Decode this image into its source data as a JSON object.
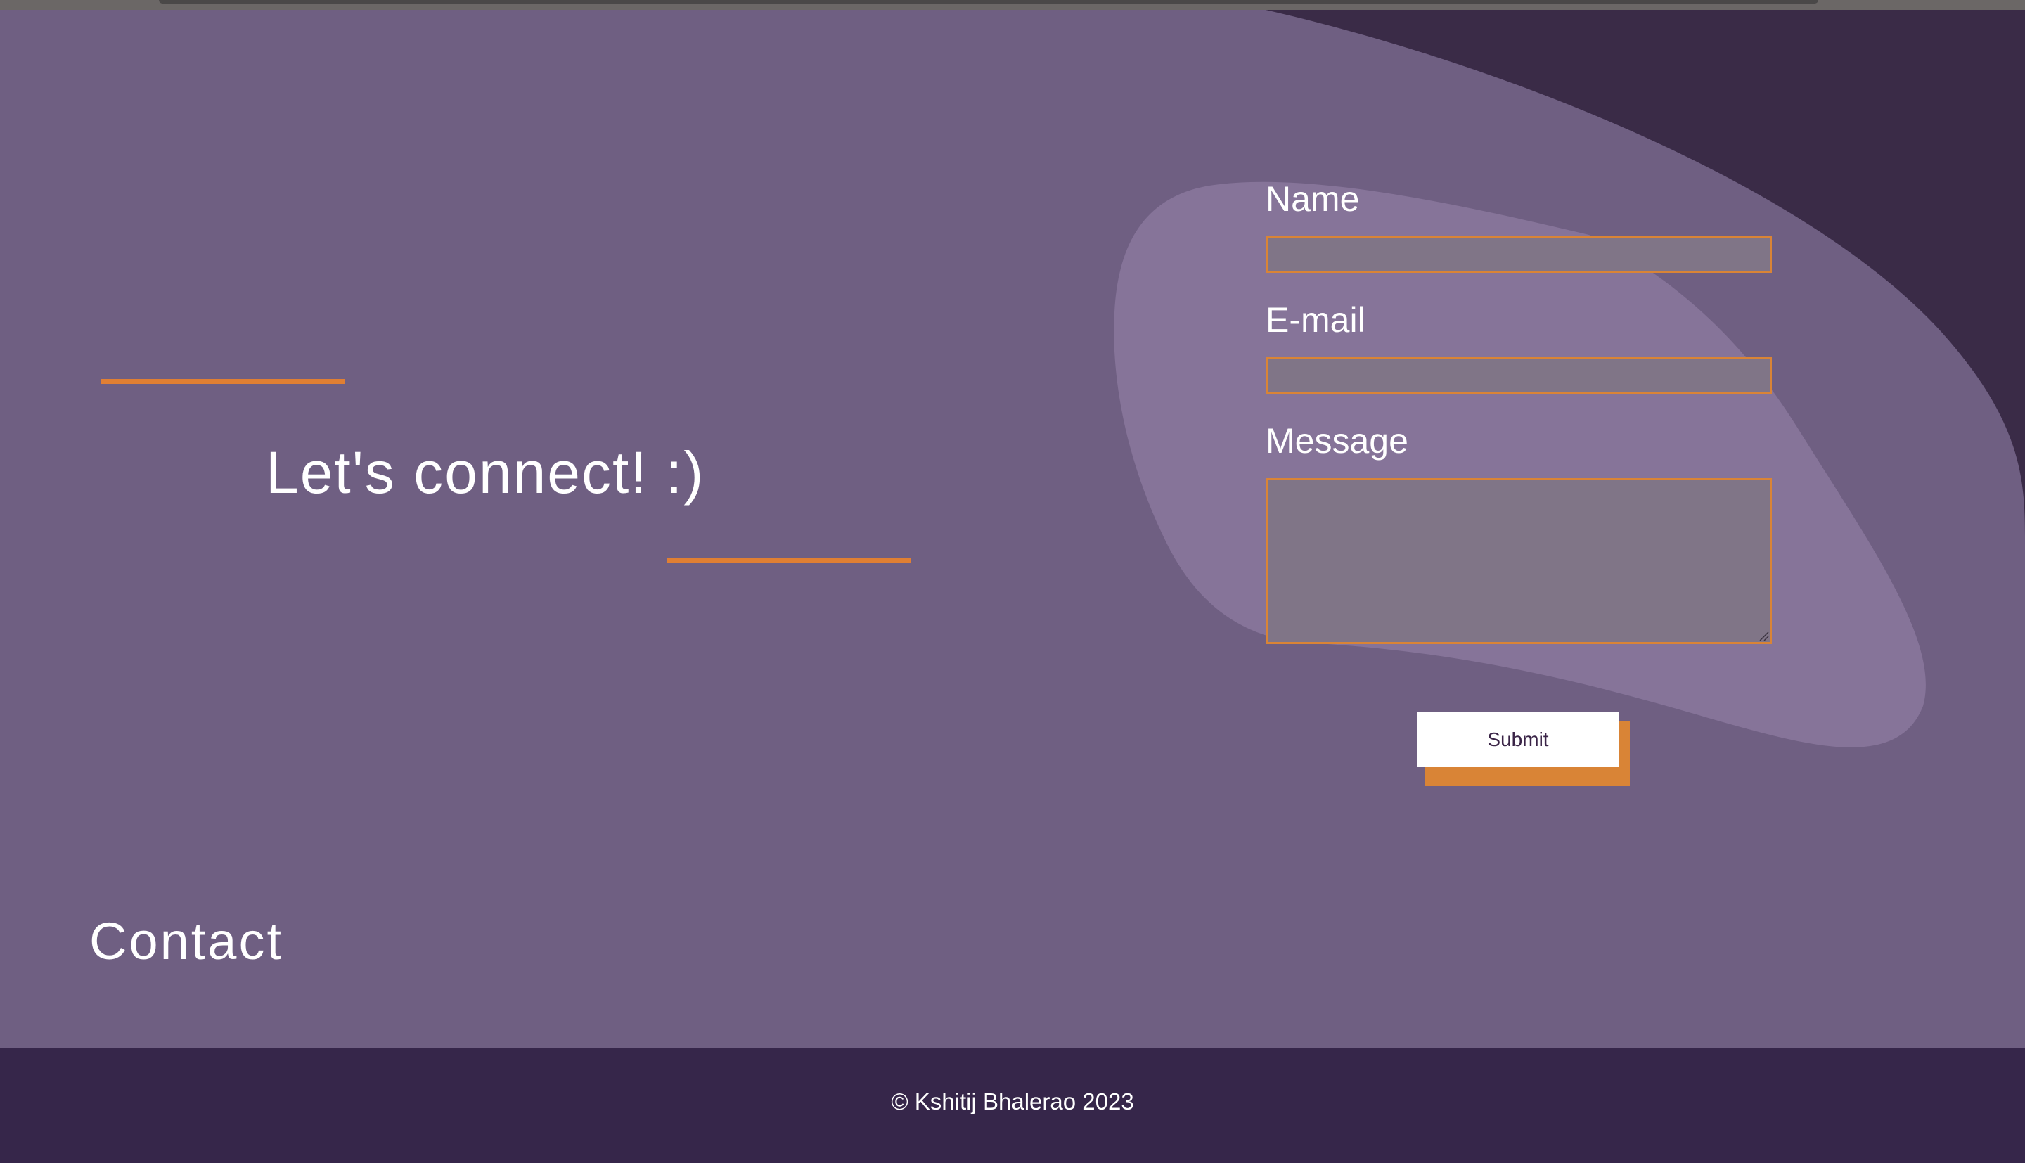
{
  "hero": {
    "tagline": "Let's connect! :)",
    "section_title": "Contact"
  },
  "form": {
    "name_label": "Name",
    "name_value": "",
    "email_label": "E-mail",
    "email_value": "",
    "message_label": "Message",
    "message_value": "",
    "submit_label": "Submit"
  },
  "footer": {
    "copyright": "© Kshitij Bhalerao 2023"
  },
  "colors": {
    "background": "#6f5f82",
    "dark_blob": "#3a2b47",
    "light_blob": "#867499",
    "accent": "#e07f33",
    "input_fill": "#807587",
    "footer": "#36264a",
    "text": "#ffffff"
  }
}
